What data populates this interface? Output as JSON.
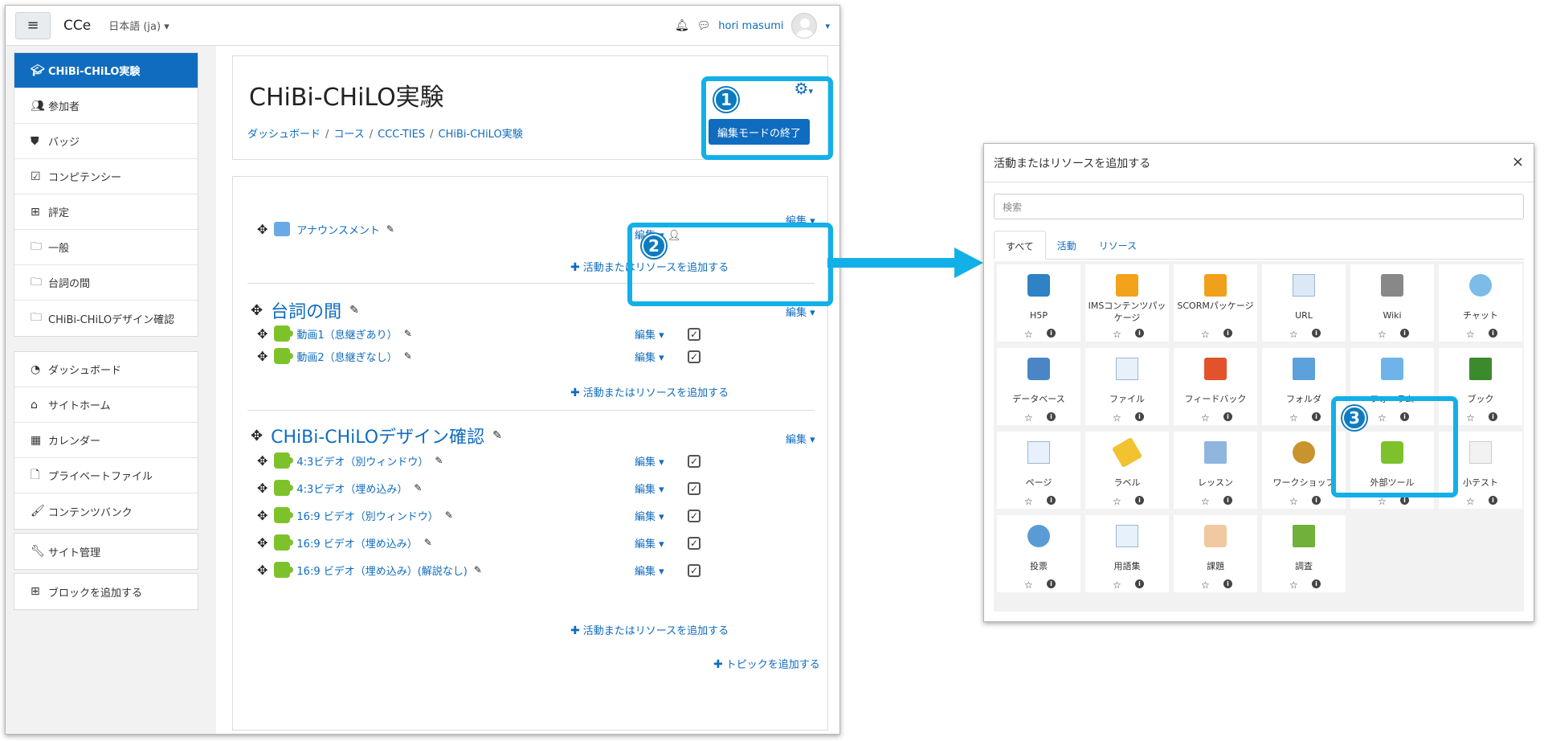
{
  "navbar": {
    "brand": "CCe",
    "language": "日本語 (ja)",
    "user_name": "hori masumi"
  },
  "drawer": {
    "group1": [
      {
        "label": "CHiBi-CHiLO実験",
        "icon": "graduation-cap-icon"
      },
      {
        "label": "参加者",
        "icon": "users-icon"
      },
      {
        "label": "バッジ",
        "icon": "shield-icon"
      },
      {
        "label": "コンピテンシー",
        "icon": "check-square-icon"
      },
      {
        "label": "評定",
        "icon": "table-icon"
      },
      {
        "label": "一般",
        "icon": "folder-icon"
      },
      {
        "label": "台詞の間",
        "icon": "folder-icon"
      },
      {
        "label": "CHiBi-CHiLOデザイン確認",
        "icon": "folder-icon"
      }
    ],
    "group2": [
      {
        "label": "ダッシュボード",
        "icon": "dashboard-icon"
      },
      {
        "label": "サイトホーム",
        "icon": "home-icon"
      },
      {
        "label": "カレンダー",
        "icon": "calendar-icon"
      },
      {
        "label": "プライベートファイル",
        "icon": "file-icon"
      },
      {
        "label": "コンテンツバンク",
        "icon": "brush-icon"
      }
    ],
    "group3": [
      {
        "label": "サイト管理",
        "icon": "wrench-icon"
      }
    ],
    "group4": [
      {
        "label": "ブロックを追加する",
        "icon": "plus-square-icon"
      }
    ]
  },
  "header": {
    "title": "CHiBi-CHiLO実験",
    "breadcrumbs": [
      "ダッシュボード",
      "コース",
      "CCC-TIES",
      "CHiBi-CHiLO実験"
    ],
    "edit_mode_button": "編集モードの終了"
  },
  "course": {
    "edit_label": "編集",
    "add_activity": "活動またはリソースを追加する",
    "add_topic": "トピックを追加する",
    "general_activity": "アナウンスメント",
    "section1": {
      "title": "台詞の間",
      "activities": [
        "動画1（息継ぎあり）",
        "動画2（息継ぎなし）"
      ]
    },
    "section2": {
      "title": "CHiBi-CHiLOデザイン確認",
      "activities": [
        "4:3ビデオ（別ウィンドウ）",
        "4:3ビデオ（埋め込み）",
        "16:9 ビデオ（別ウィンドウ）",
        "16:9 ビデオ（埋め込み）",
        "16:9 ビデオ（埋め込み）(解説なし)"
      ]
    }
  },
  "annotations": {
    "badge1": "1",
    "badge2": "2",
    "badge3": "3",
    "highlight_color": "#12b0e8"
  },
  "modal": {
    "title": "活動またはリソースを追加する",
    "close": "×",
    "search_placeholder": "検索",
    "tabs": [
      "すべて",
      "活動",
      "リソース"
    ],
    "tiles": [
      {
        "name": "H5P",
        "icon": "h5p-icon"
      },
      {
        "name": "IMSコンテンツパッケージ",
        "icon": "ims-package-icon"
      },
      {
        "name": "SCORMパッケージ",
        "icon": "scorm-icon"
      },
      {
        "name": "URL",
        "icon": "url-icon"
      },
      {
        "name": "Wiki",
        "icon": "wiki-icon"
      },
      {
        "name": "チャット",
        "icon": "chat-icon"
      },
      {
        "name": "データベース",
        "icon": "database-icon"
      },
      {
        "name": "ファイル",
        "icon": "file-icon"
      },
      {
        "name": "フィードバック",
        "icon": "megaphone-icon"
      },
      {
        "name": "フォルダ",
        "icon": "folder-icon"
      },
      {
        "name": "フォーラム",
        "icon": "forum-icon"
      },
      {
        "name": "ブック",
        "icon": "book-icon"
      },
      {
        "name": "ページ",
        "icon": "page-icon"
      },
      {
        "name": "ラベル",
        "icon": "label-icon"
      },
      {
        "name": "レッスン",
        "icon": "lesson-icon"
      },
      {
        "name": "ワークショップ",
        "icon": "workshop-icon"
      },
      {
        "name": "外部ツール",
        "icon": "puzzle-icon"
      },
      {
        "name": "小テスト",
        "icon": "quiz-icon"
      },
      {
        "name": "投票",
        "icon": "choice-icon"
      },
      {
        "name": "用語集",
        "icon": "glossary-icon"
      },
      {
        "name": "課題",
        "icon": "assignment-icon"
      },
      {
        "name": "調査",
        "icon": "survey-icon"
      }
    ]
  }
}
